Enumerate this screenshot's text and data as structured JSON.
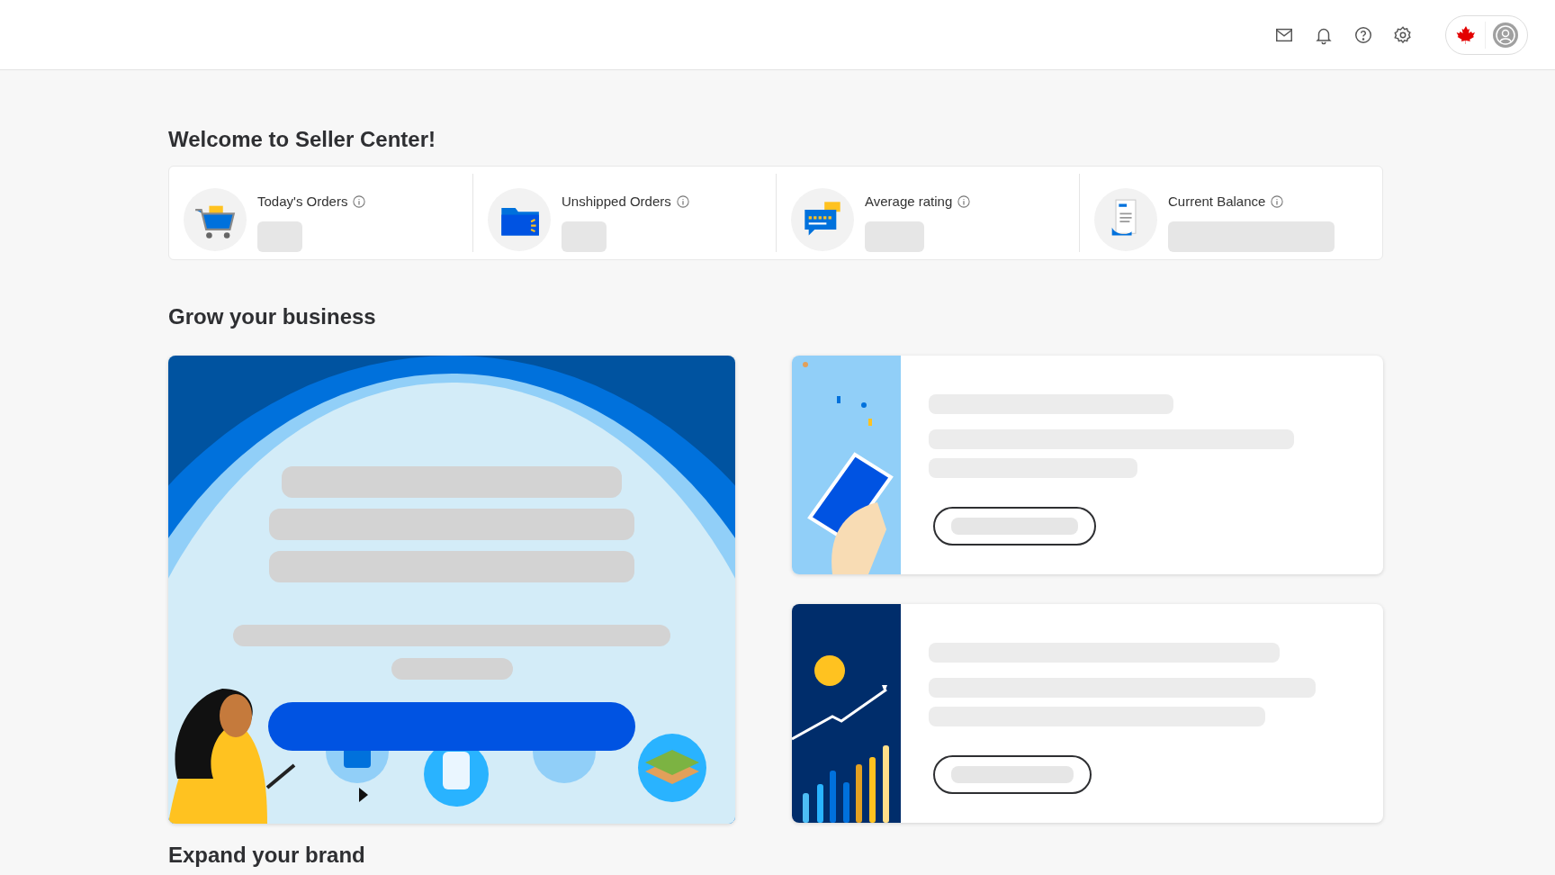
{
  "page_title": "Welcome to Seller Center!",
  "stats": [
    {
      "label": "Today's Orders",
      "kind": "cart"
    },
    {
      "label": "Unshipped Orders",
      "kind": "folder"
    },
    {
      "label": "Average rating",
      "kind": "rating"
    },
    {
      "label": "Current Balance",
      "kind": "receipt"
    }
  ],
  "grow_section": {
    "title": "Grow your business"
  },
  "expand_section": {
    "title": "Expand your brand"
  }
}
